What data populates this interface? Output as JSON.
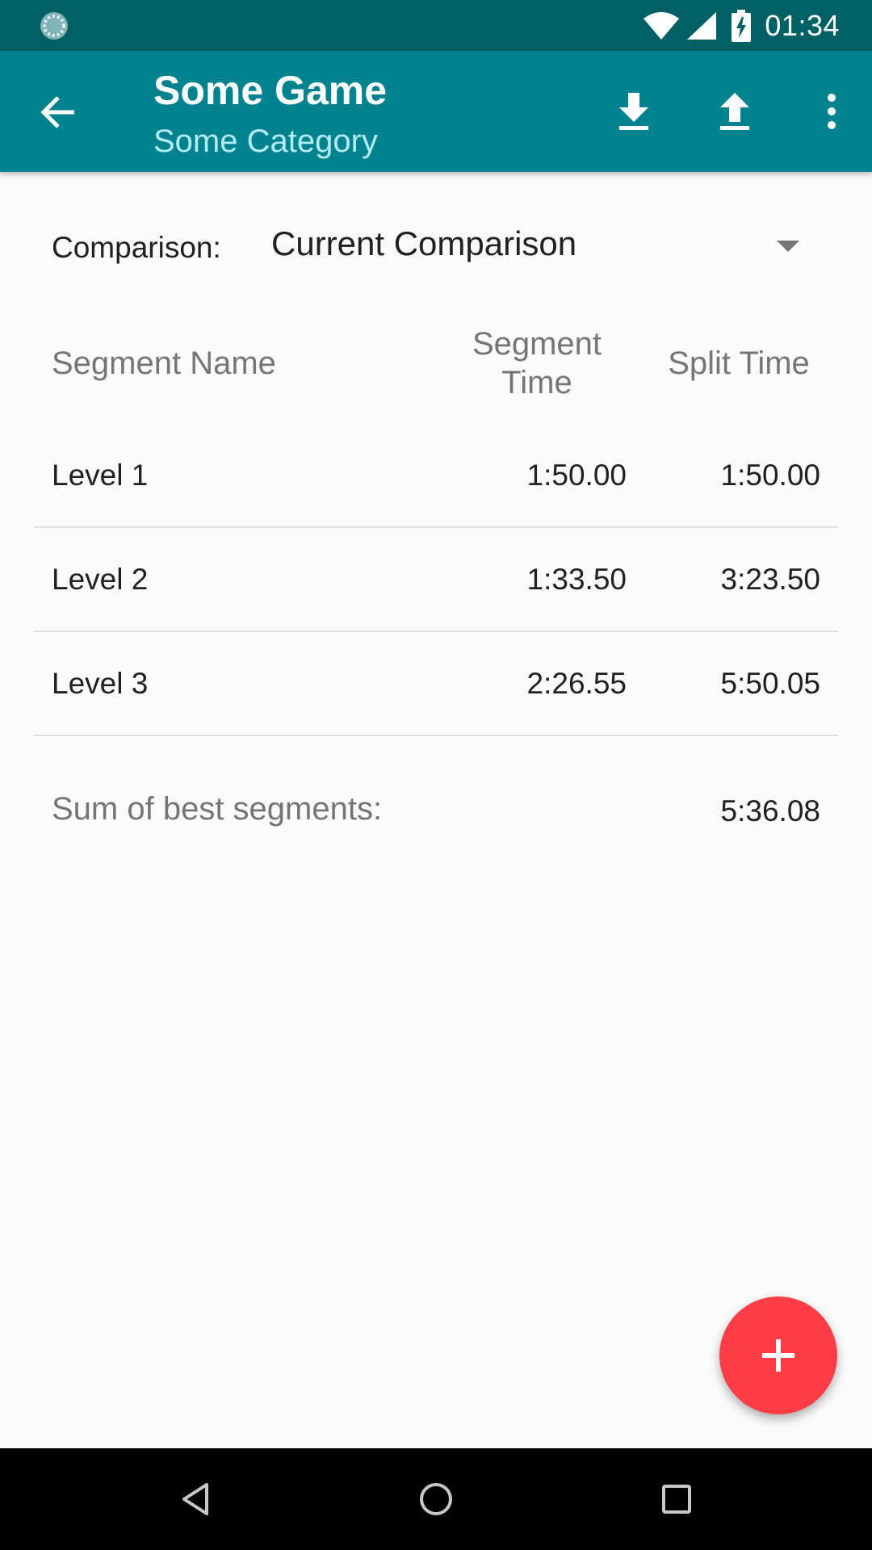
{
  "status_bar": {
    "time": "01:34",
    "icons": [
      "sync-spinner-icon",
      "wifi-icon",
      "signal-icon",
      "battery-charging-icon"
    ]
  },
  "app_bar": {
    "title": "Some Game",
    "subtitle": "Some Category",
    "actions": [
      "back-arrow-icon",
      "download-icon",
      "upload-icon",
      "more-vert-icon"
    ]
  },
  "comparison": {
    "label": "Comparison:",
    "selected": "Current Comparison"
  },
  "table": {
    "headers": {
      "segment_name": "Segment Name",
      "segment_time_line1": "Segment",
      "segment_time_line2": "Time",
      "split_time": "Split Time"
    },
    "rows": [
      {
        "name": "Level 1",
        "segment_time": "1:50.00",
        "split_time": "1:50.00"
      },
      {
        "name": "Level 2",
        "segment_time": "1:33.50",
        "split_time": "3:23.50"
      },
      {
        "name": "Level 3",
        "segment_time": "2:26.55",
        "split_time": "5:50.05"
      }
    ]
  },
  "summary": {
    "label": "Sum of best segments:",
    "value": "5:36.08"
  },
  "fab": {
    "icon": "add-icon"
  },
  "colors": {
    "status_bar": "#006064",
    "app_bar": "#00838f",
    "subtitle": "#b2ebf2",
    "fab": "#ff3d47",
    "background": "#fafafa"
  },
  "nav_bar": {
    "icons": [
      "nav-back-icon",
      "nav-home-icon",
      "nav-recents-icon"
    ]
  }
}
